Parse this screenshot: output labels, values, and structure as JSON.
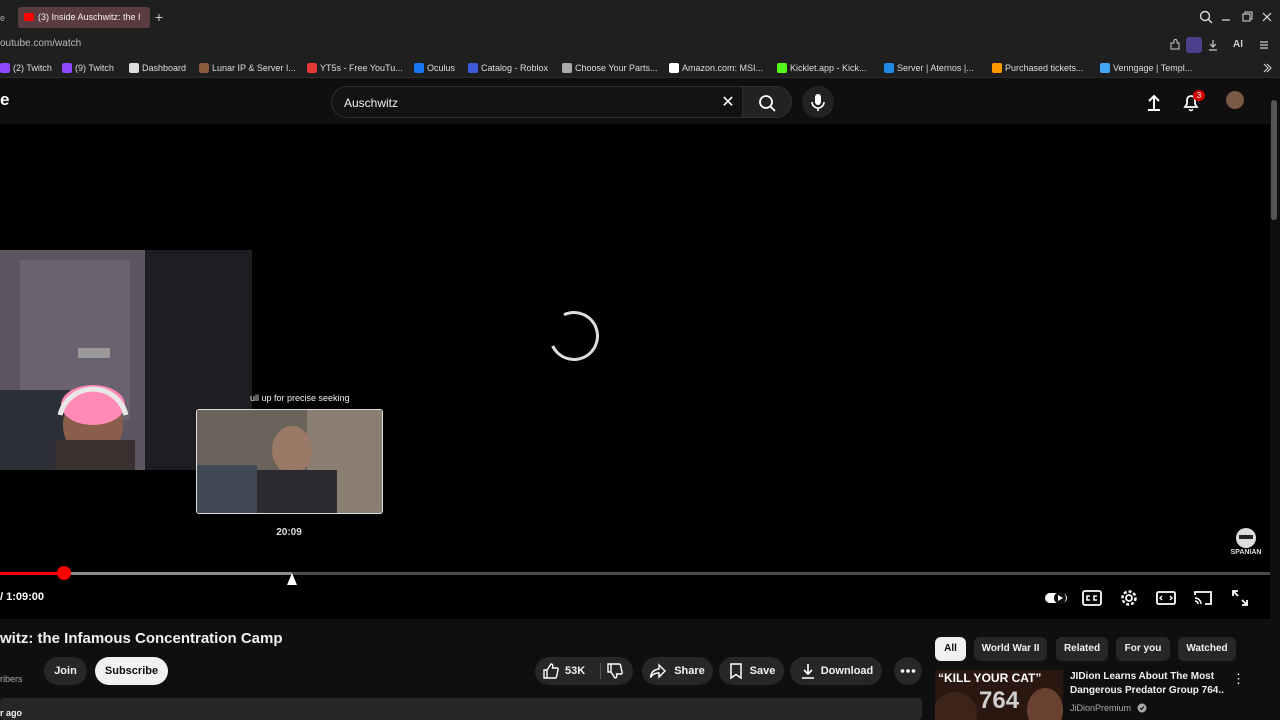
{
  "browser": {
    "tab_fragment": "e",
    "active_tab_title": "(3) Inside Auschwitz: the I",
    "new_tab": "+",
    "url": "outube.com/watch",
    "bookmarks": [
      {
        "label": "(2) Twitch",
        "color": "#9146ff"
      },
      {
        "label": "(9) Twitch",
        "color": "#9146ff"
      },
      {
        "label": "Dashboard",
        "color": "#dddddd"
      },
      {
        "label": "Lunar IP & Server I...",
        "color": "#8b5a3c"
      },
      {
        "label": "YT5s - Free YouTu...",
        "color": "#e53935"
      },
      {
        "label": "Oculus",
        "color": "#1877f2"
      },
      {
        "label": "Catalog - Roblox",
        "color": "#3b5bdb"
      },
      {
        "label": "Choose Your Parts...",
        "color": "#aaaaaa"
      },
      {
        "label": "Amazon.com: MSI...",
        "color": "#ffffff"
      },
      {
        "label": "Kicklet.app - Kick...",
        "color": "#53fc18"
      },
      {
        "label": "Server | Aternos |...",
        "color": "#1e88e5"
      },
      {
        "label": "Purchased tickets...",
        "color": "#ff9800"
      },
      {
        "label": "Venngage | Templ...",
        "color": "#42a5f5"
      }
    ],
    "extension_ai_label": "AI"
  },
  "youtube": {
    "logo_fragment": "e",
    "search": {
      "value": "Auschwitz",
      "clear": "✕"
    },
    "notifications_count": "3"
  },
  "player": {
    "seek_hint": "ull up for precise seeking",
    "preview_time": "20:09",
    "time_display": "/ 1:09:00",
    "watermark": "SPANIAN",
    "played_fraction": 0.05,
    "buffered_fraction": 0.23
  },
  "video": {
    "title": "witz: the Infamous Concentration Camp",
    "subscribers_fragment": "ribers",
    "join_label": "Join",
    "subscribe_label": "Subscribe",
    "likes": "53K",
    "share_label": "Share",
    "save_label": "Save",
    "download_label": "Download",
    "uploaded_fragment": "r ago"
  },
  "sidebar": {
    "chips": [
      "All",
      "World War II",
      "Related",
      "For you",
      "Watched"
    ],
    "recommendation": {
      "thumb_text": "“KILL YOUR CAT”",
      "thumb_number": "764",
      "title": "JIDion Learns About The Most Dangerous Predator Group 764..",
      "channel": "JiDionPremium"
    }
  },
  "colors": {
    "accent": "#ff0000",
    "background": "#0f0f0f",
    "pill": "#272727"
  }
}
